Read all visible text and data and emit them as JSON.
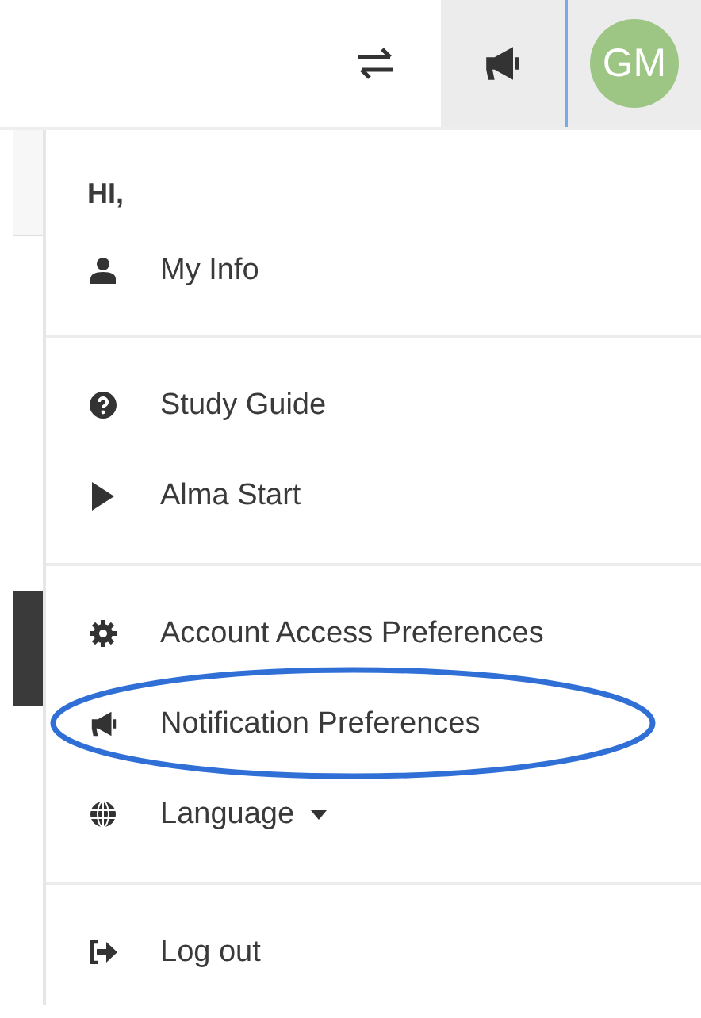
{
  "top_bar": {
    "avatar": {
      "initials": "GM"
    }
  },
  "menu": {
    "greeting": "HI,",
    "sections": [
      {
        "items": [
          {
            "kind": "user",
            "label": "My Info",
            "highlighted": false,
            "has_dropdown": false
          }
        ]
      },
      {
        "items": [
          {
            "kind": "question",
            "label": "Study Guide",
            "highlighted": false,
            "has_dropdown": false
          },
          {
            "kind": "play",
            "label": "Alma Start",
            "highlighted": false,
            "has_dropdown": false
          }
        ]
      },
      {
        "items": [
          {
            "kind": "gear",
            "label": "Account Access Preferences",
            "highlighted": false,
            "has_dropdown": false
          },
          {
            "kind": "megaphone",
            "label": "Notification Preferences",
            "highlighted": true,
            "has_dropdown": false
          },
          {
            "kind": "globe",
            "label": "Language",
            "highlighted": false,
            "has_dropdown": true
          }
        ]
      },
      {
        "items": [
          {
            "kind": "logout",
            "label": "Log out",
            "highlighted": false,
            "has_dropdown": false
          }
        ]
      }
    ]
  }
}
